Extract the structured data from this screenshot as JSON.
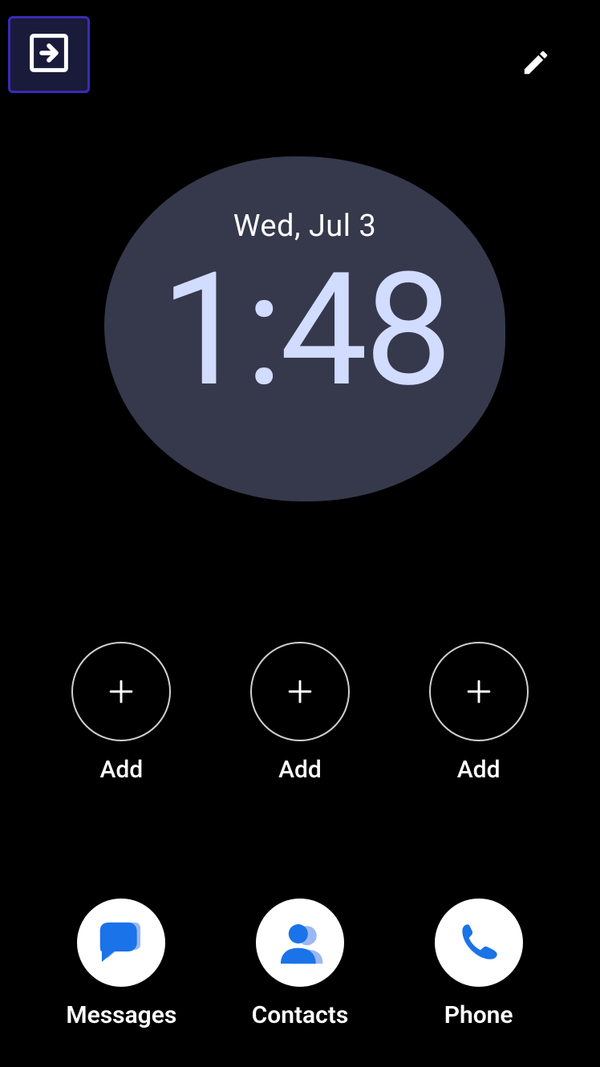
{
  "clock": {
    "date": "Wed, Jul 3",
    "time": "1:48"
  },
  "shortcuts": [
    {
      "label": "Add"
    },
    {
      "label": "Add"
    },
    {
      "label": "Add"
    }
  ],
  "dock": [
    {
      "label": "Messages"
    },
    {
      "label": "Contacts"
    },
    {
      "label": "Phone"
    }
  ],
  "colors": {
    "clock_bg": "#36394c",
    "clock_time": "#d1dcff",
    "highlight_border": "#3a2ab5"
  },
  "icons": {
    "exit": "exit-icon",
    "edit": "pencil-icon",
    "plus": "plus-icon",
    "messages": "messages-icon",
    "contacts": "contacts-icon",
    "phone": "phone-icon"
  }
}
